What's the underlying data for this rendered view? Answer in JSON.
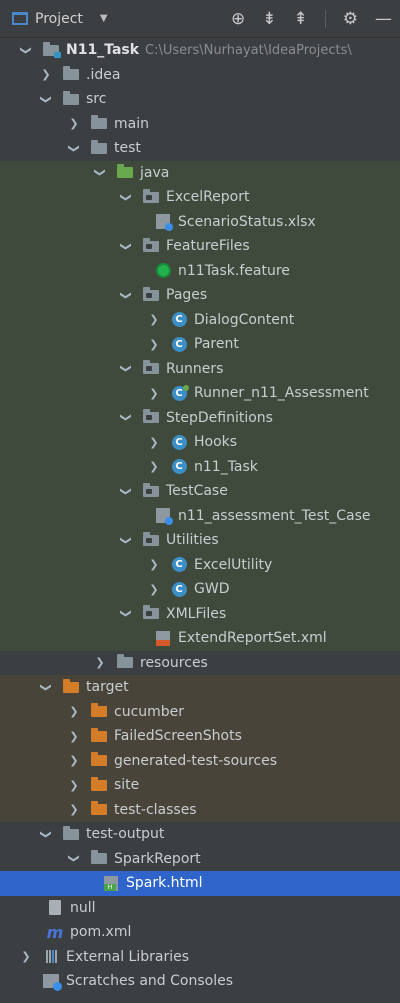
{
  "toolbar": {
    "title": "Project"
  },
  "tree": {
    "project_root": "N11_Task",
    "project_path": "C:\\Users\\Nurhayat\\IdeaProjects\\",
    "idea": ".idea",
    "src": "src",
    "main": "main",
    "test": "test",
    "java": "java",
    "excelreport": "ExcelReport",
    "scenariostatus": "ScenarioStatus.xlsx",
    "featurefiles": "FeatureFiles",
    "feature": "n11Task.feature",
    "pages": "Pages",
    "dialogcontent": "DialogContent",
    "parent": "Parent",
    "runners": "Runners",
    "runner": "Runner_n11_Assessment",
    "stepdefinitions": "StepDefinitions",
    "hooks": "Hooks",
    "n11task": "n11_Task",
    "testcase": "TestCase",
    "testcase_file": "n11_assessment_Test_Case",
    "utilities": "Utilities",
    "excelutility": "ExcelUtility",
    "gwd": "GWD",
    "xmlfiles": "XMLFiles",
    "extendreport": "ExtendReportSet.xml",
    "resources": "resources",
    "target": "target",
    "cucumber": "cucumber",
    "failedscreenshots": "FailedScreenShots",
    "generated": "generated-test-sources",
    "site": "site",
    "testclasses": "test-classes",
    "testoutput": "test-output",
    "sparkreport": "SparkReport",
    "sparkhtml": "Spark.html",
    "null": "null",
    "pom": "pom.xml",
    "extlibs": "External Libraries",
    "scratches": "Scratches and Consoles"
  },
  "icons": {
    "class_letter": "C",
    "maven_letter": "m"
  },
  "colors": {
    "selected": "#2f65ca",
    "test_highlight": "#3f4a3c",
    "excluded_highlight": "#48443a"
  }
}
